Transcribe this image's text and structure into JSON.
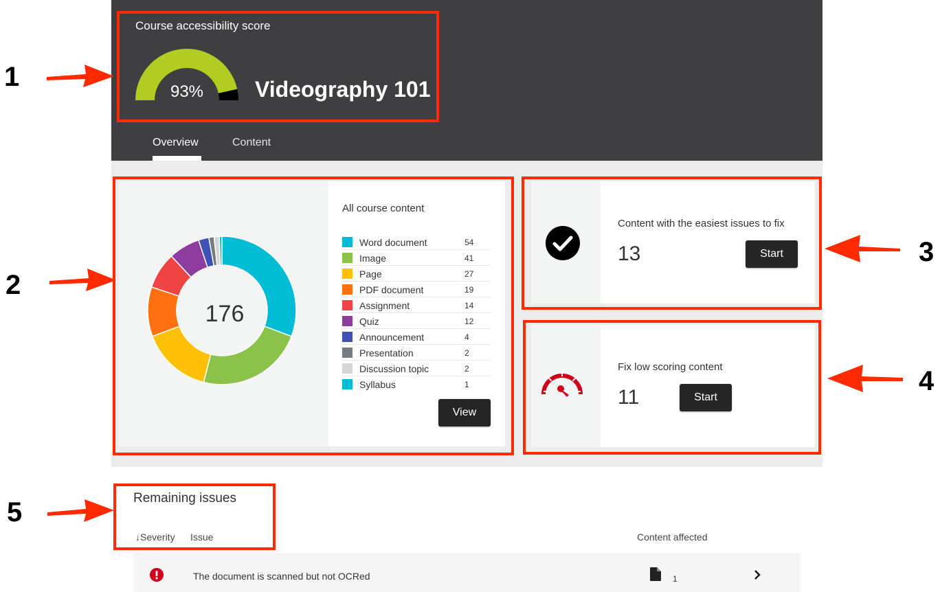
{
  "header": {
    "score_label": "Course accessibility score",
    "score_value": "93%",
    "score_fraction": 0.93,
    "course_title": "Videography 101",
    "tabs": [
      {
        "label": "Overview",
        "active": true
      },
      {
        "label": "Content",
        "active": false
      }
    ]
  },
  "content_overview": {
    "title": "All course content",
    "total": "176",
    "view_label": "View",
    "items": [
      {
        "label": "Word document",
        "count": "54",
        "value": 54,
        "color": "#00bcd4"
      },
      {
        "label": "Image",
        "count": "41",
        "value": 41,
        "color": "#8bc34a"
      },
      {
        "label": "Page",
        "count": "27",
        "value": 27,
        "color": "#ffc107"
      },
      {
        "label": "PDF document",
        "count": "19",
        "value": 19,
        "color": "#ff7010"
      },
      {
        "label": "Assignment",
        "count": "14",
        "value": 14,
        "color": "#f04444"
      },
      {
        "label": "Quiz",
        "count": "12",
        "value": 12,
        "color": "#8e3c9e"
      },
      {
        "label": "Announcement",
        "count": "4",
        "value": 4,
        "color": "#3f51b5"
      },
      {
        "label": "Presentation",
        "count": "2",
        "value": 2,
        "color": "#757c82"
      },
      {
        "label": "Discussion topic",
        "count": "2",
        "value": 2,
        "color": "#d6d6d6"
      },
      {
        "label": "Syllabus",
        "count": "1",
        "value": 1,
        "color": "#00bcd4"
      }
    ]
  },
  "easy_fix": {
    "title": "Content with the easiest issues to fix",
    "count": "13",
    "start_label": "Start",
    "icon": "check-circle-icon"
  },
  "low_score": {
    "title": "Fix low scoring content",
    "count": "11",
    "start_label": "Start",
    "icon": "speedometer-icon",
    "accent": "#d0021b"
  },
  "remaining": {
    "title": "Remaining issues",
    "col_severity": "Severity",
    "col_issue": "Issue",
    "col_affected": "Content affected",
    "rows": [
      {
        "text": "The document is scanned but not OCRed",
        "count": "1",
        "severity": "error"
      }
    ]
  },
  "annotations": {
    "steps": [
      "1",
      "2",
      "3",
      "4",
      "5"
    ],
    "color": "#ff2a00"
  },
  "colors": {
    "header_bg": "#3f3f42",
    "gauge_fill": "#b3cc22",
    "button_bg": "#262626"
  }
}
